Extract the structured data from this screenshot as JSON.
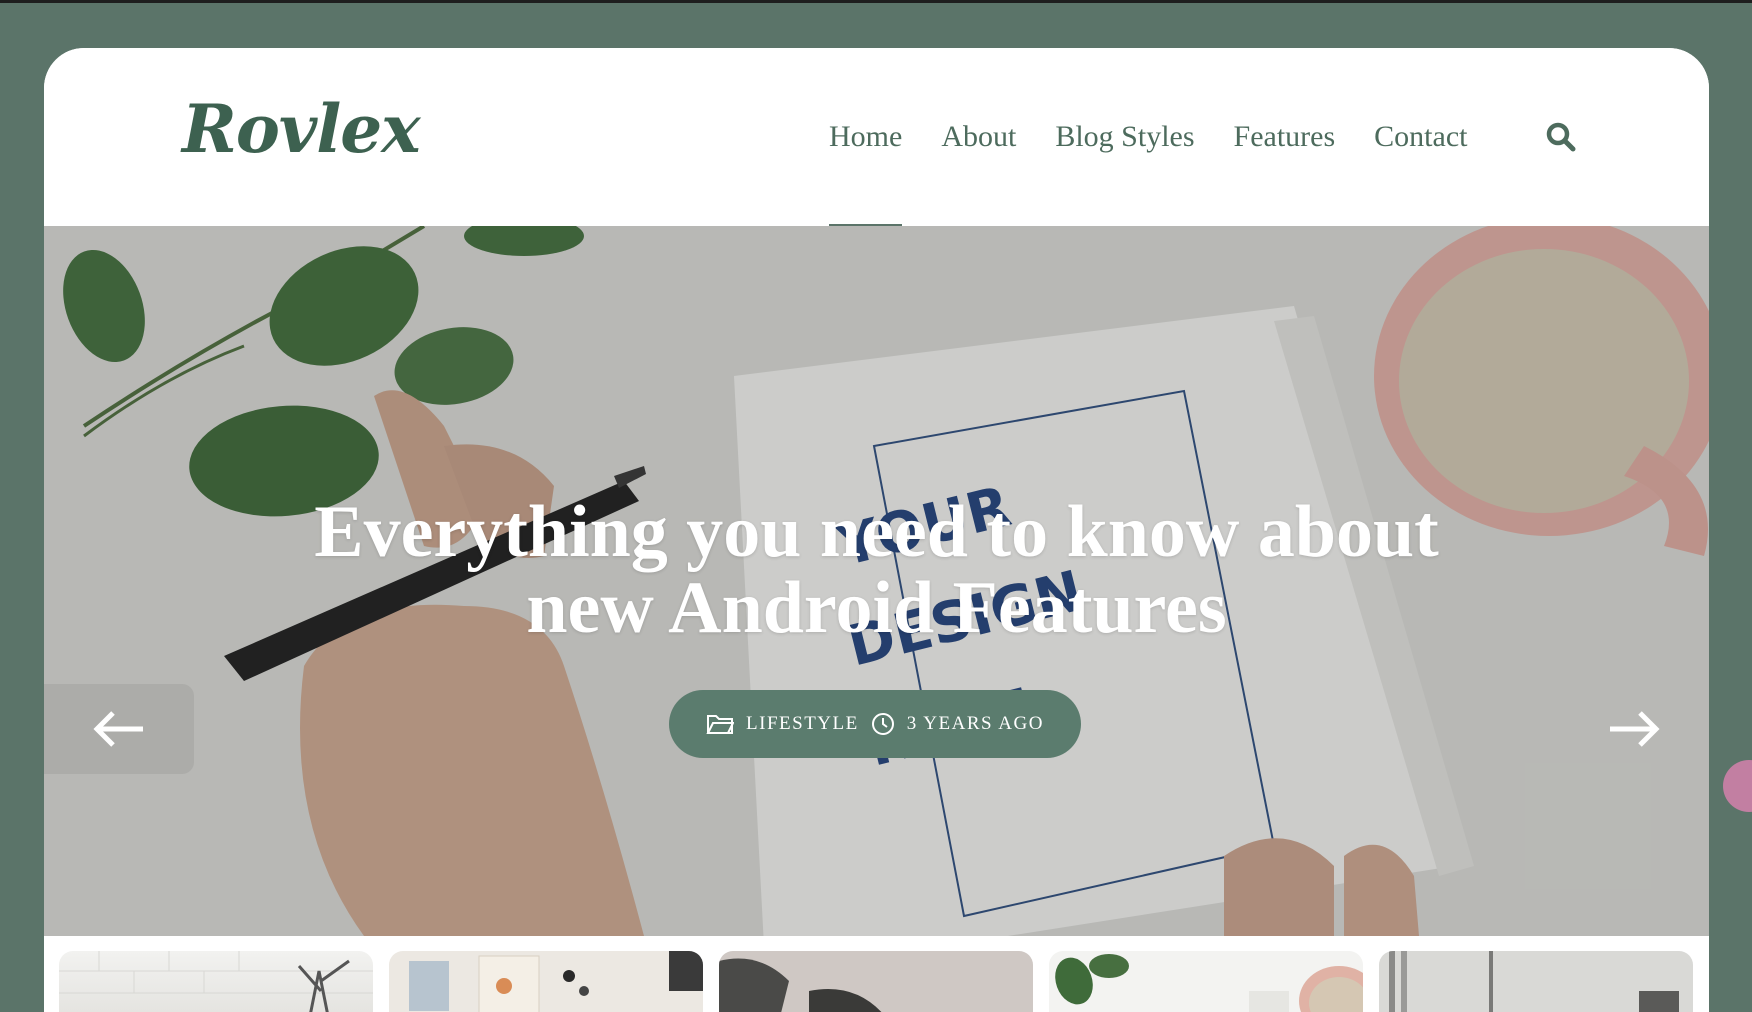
{
  "brand": {
    "logo_text": "Rovlex"
  },
  "nav": {
    "items": [
      {
        "label": "Home",
        "active": true
      },
      {
        "label": "About",
        "active": false
      },
      {
        "label": "Blog Styles",
        "active": false
      },
      {
        "label": "Features",
        "active": false
      },
      {
        "label": "Contact",
        "active": false
      }
    ],
    "search_icon": "search-icon"
  },
  "hero": {
    "title_line1": "Everything you need to know about",
    "title_line2": "new Android Features",
    "category": "LIFESTYLE",
    "date": "3 YEARS AGO",
    "category_icon": "folder-icon",
    "date_icon": "clock-icon",
    "prev_icon": "arrow-left-icon",
    "next_icon": "arrow-right-icon"
  },
  "colors": {
    "background": "#5b7469",
    "accent": "#5b7c6e",
    "nav_text": "#4d6b5d",
    "logo": "#3d6150"
  }
}
